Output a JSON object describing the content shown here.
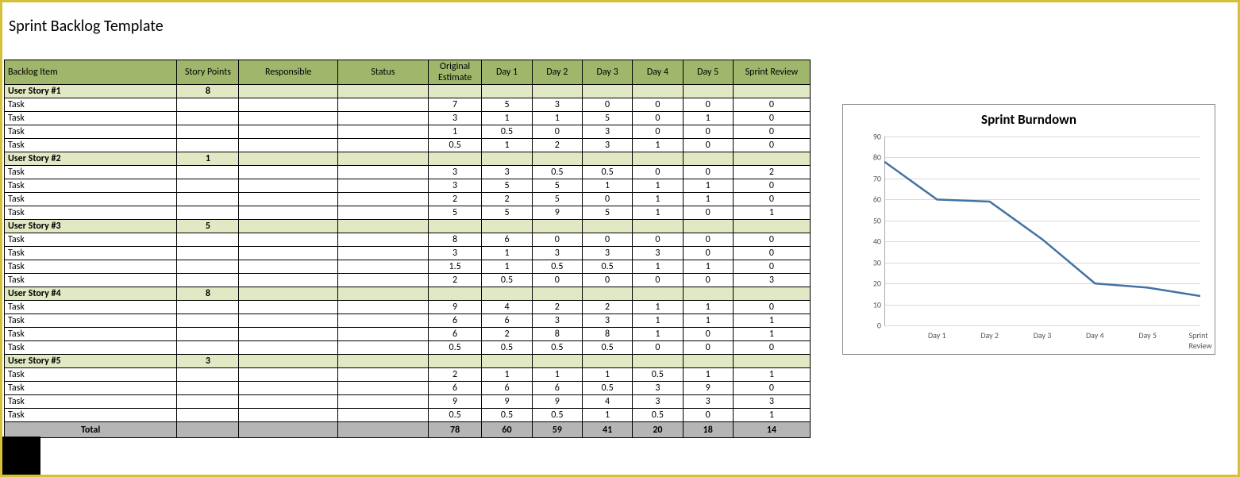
{
  "title": "Sprint Backlog Template",
  "columns": [
    "Backlog Item",
    "Story Points",
    "Responsible",
    "Status",
    "Original Estimate",
    "Day 1",
    "Day 2",
    "Day 3",
    "Day 4",
    "Day 5",
    "Sprint Review"
  ],
  "stories": [
    {
      "name": "User Story #1",
      "points": "8",
      "tasks": [
        {
          "name": "Task",
          "oe": "7",
          "d1": "5",
          "d2": "3",
          "d3": "0",
          "d4": "0",
          "d5": "0",
          "rev": "0"
        },
        {
          "name": "Task",
          "oe": "3",
          "d1": "1",
          "d2": "1",
          "d3": "5",
          "d4": "0",
          "d5": "1",
          "rev": "0"
        },
        {
          "name": "Task",
          "oe": "1",
          "d1": "0.5",
          "d2": "0",
          "d3": "3",
          "d4": "0",
          "d5": "0",
          "rev": "0"
        },
        {
          "name": "Task",
          "oe": "0.5",
          "d1": "1",
          "d2": "2",
          "d3": "3",
          "d4": "1",
          "d5": "0",
          "rev": "0"
        }
      ]
    },
    {
      "name": "User Story #2",
      "points": "1",
      "tasks": [
        {
          "name": "Task",
          "oe": "3",
          "d1": "3",
          "d2": "0.5",
          "d3": "0.5",
          "d4": "0",
          "d5": "0",
          "rev": "2"
        },
        {
          "name": "Task",
          "oe": "3",
          "d1": "5",
          "d2": "5",
          "d3": "1",
          "d4": "1",
          "d5": "1",
          "rev": "0"
        },
        {
          "name": "Task",
          "oe": "2",
          "d1": "2",
          "d2": "5",
          "d3": "0",
          "d4": "1",
          "d5": "1",
          "rev": "0"
        },
        {
          "name": "Task",
          "oe": "5",
          "d1": "5",
          "d2": "9",
          "d3": "5",
          "d4": "1",
          "d5": "0",
          "rev": "1"
        }
      ]
    },
    {
      "name": "User Story #3",
      "points": "5",
      "tasks": [
        {
          "name": "Task",
          "oe": "8",
          "d1": "6",
          "d2": "0",
          "d3": "0",
          "d4": "0",
          "d5": "0",
          "rev": "0"
        },
        {
          "name": "Task",
          "oe": "3",
          "d1": "1",
          "d2": "3",
          "d3": "3",
          "d4": "3",
          "d5": "0",
          "rev": "0"
        },
        {
          "name": "Task",
          "oe": "1.5",
          "d1": "1",
          "d2": "0.5",
          "d3": "0.5",
          "d4": "1",
          "d5": "1",
          "rev": "0"
        },
        {
          "name": "Task",
          "oe": "2",
          "d1": "0.5",
          "d2": "0",
          "d3": "0",
          "d4": "0",
          "d5": "0",
          "rev": "3"
        }
      ]
    },
    {
      "name": "User Story #4",
      "points": "8",
      "tasks": [
        {
          "name": "Task",
          "oe": "9",
          "d1": "4",
          "d2": "2",
          "d3": "2",
          "d4": "1",
          "d5": "1",
          "rev": "0"
        },
        {
          "name": "Task",
          "oe": "6",
          "d1": "6",
          "d2": "3",
          "d3": "3",
          "d4": "1",
          "d5": "1",
          "rev": "1"
        },
        {
          "name": "Task",
          "oe": "6",
          "d1": "2",
          "d2": "8",
          "d3": "8",
          "d4": "1",
          "d5": "0",
          "rev": "1"
        },
        {
          "name": "Task",
          "oe": "0.5",
          "d1": "0.5",
          "d2": "0.5",
          "d3": "0.5",
          "d4": "0",
          "d5": "0",
          "rev": "0"
        }
      ]
    },
    {
      "name": "User Story #5",
      "points": "3",
      "tasks": [
        {
          "name": "Task",
          "oe": "2",
          "d1": "1",
          "d2": "1",
          "d3": "1",
          "d4": "0.5",
          "d5": "1",
          "rev": "1"
        },
        {
          "name": "Task",
          "oe": "6",
          "d1": "6",
          "d2": "6",
          "d3": "0.5",
          "d4": "3",
          "d5": "9",
          "rev": "0"
        },
        {
          "name": "Task",
          "oe": "9",
          "d1": "9",
          "d2": "9",
          "d3": "4",
          "d4": "3",
          "d5": "3",
          "rev": "3"
        },
        {
          "name": "Task",
          "oe": "0.5",
          "d1": "0.5",
          "d2": "0.5",
          "d3": "1",
          "d4": "0.5",
          "d5": "0",
          "rev": "1"
        }
      ]
    }
  ],
  "total": {
    "label": "Total",
    "oe": "78",
    "d1": "60",
    "d2": "59",
    "d3": "41",
    "d4": "20",
    "d5": "18",
    "rev": "14"
  },
  "chart_data": {
    "type": "line",
    "title": "Sprint Burndown",
    "categories": [
      "Day 1",
      "Day 2",
      "Day 3",
      "Day 4",
      "Day 5",
      "Sprint Review"
    ],
    "values": [
      78,
      60,
      59,
      41,
      20,
      18,
      14
    ],
    "ylim": [
      0,
      90
    ],
    "yticks": [
      0,
      10,
      20,
      30,
      40,
      50,
      60,
      70,
      80,
      90
    ],
    "series_color": "#4472a4"
  }
}
